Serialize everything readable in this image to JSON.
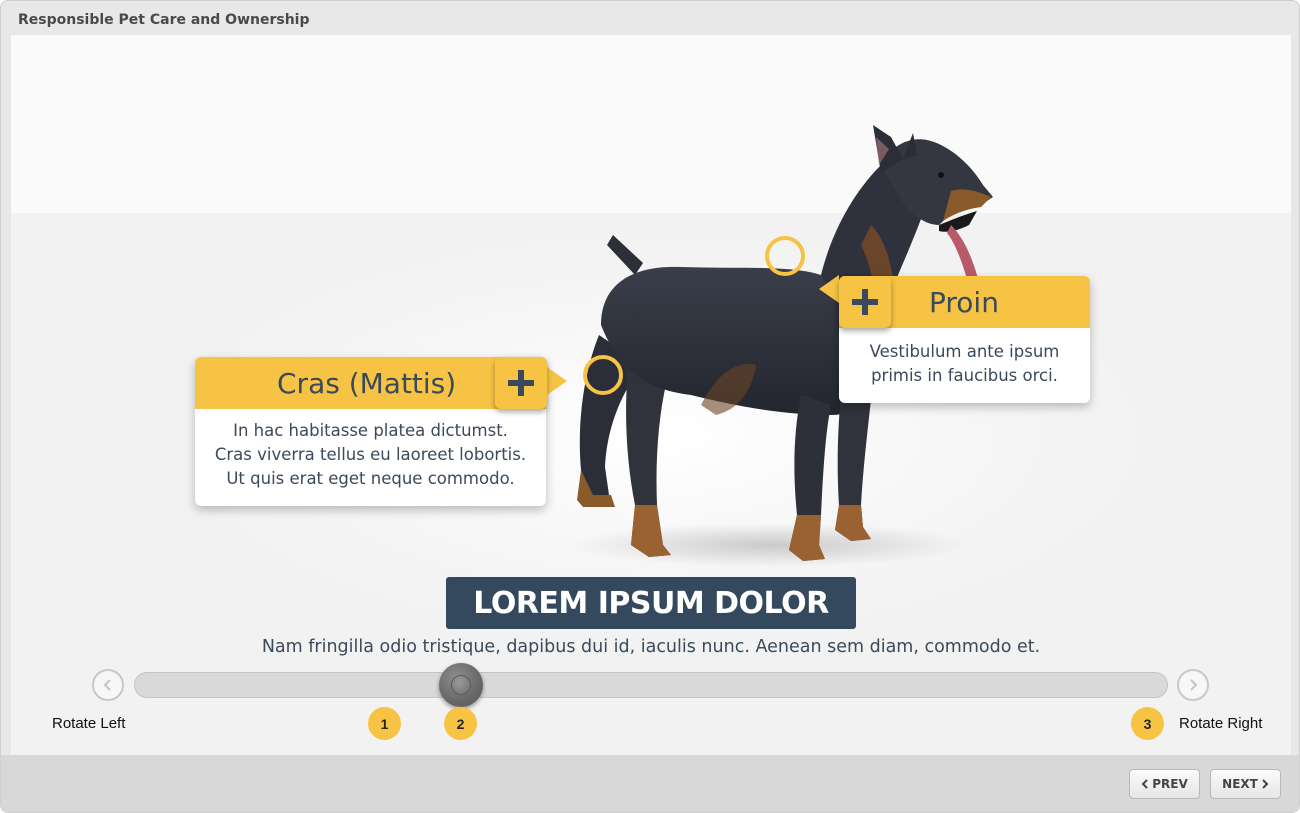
{
  "window": {
    "title": "Responsible Pet Care and Ownership"
  },
  "callouts": [
    {
      "title": "Cras (Mattis)",
      "body": [
        "In hac habitasse platea dictumst.",
        "Cras viverra tellus eu laoreet lobortis.",
        "Ut quis erat eget neque commodo."
      ]
    },
    {
      "title": "Proin",
      "body": [
        "Vestibulum ante ipsum",
        "primis in faucibus orci."
      ]
    }
  ],
  "headline": "LOREM IPSUM DOLOR",
  "description": "Nam fringilla odio tristique, dapibus dui id, iaculis nunc. Aenean sem diam, commodo et.",
  "slider": {
    "left_label": "Rotate Left",
    "right_label": "Rotate Right",
    "markers": [
      "1",
      "2",
      "3"
    ],
    "current_marker": "2"
  },
  "footer": {
    "prev_label": "PREV",
    "next_label": "NEXT"
  },
  "colors": {
    "accent": "#f6c344",
    "headline_bg": "#34495e",
    "text": "#3b4a5a"
  }
}
